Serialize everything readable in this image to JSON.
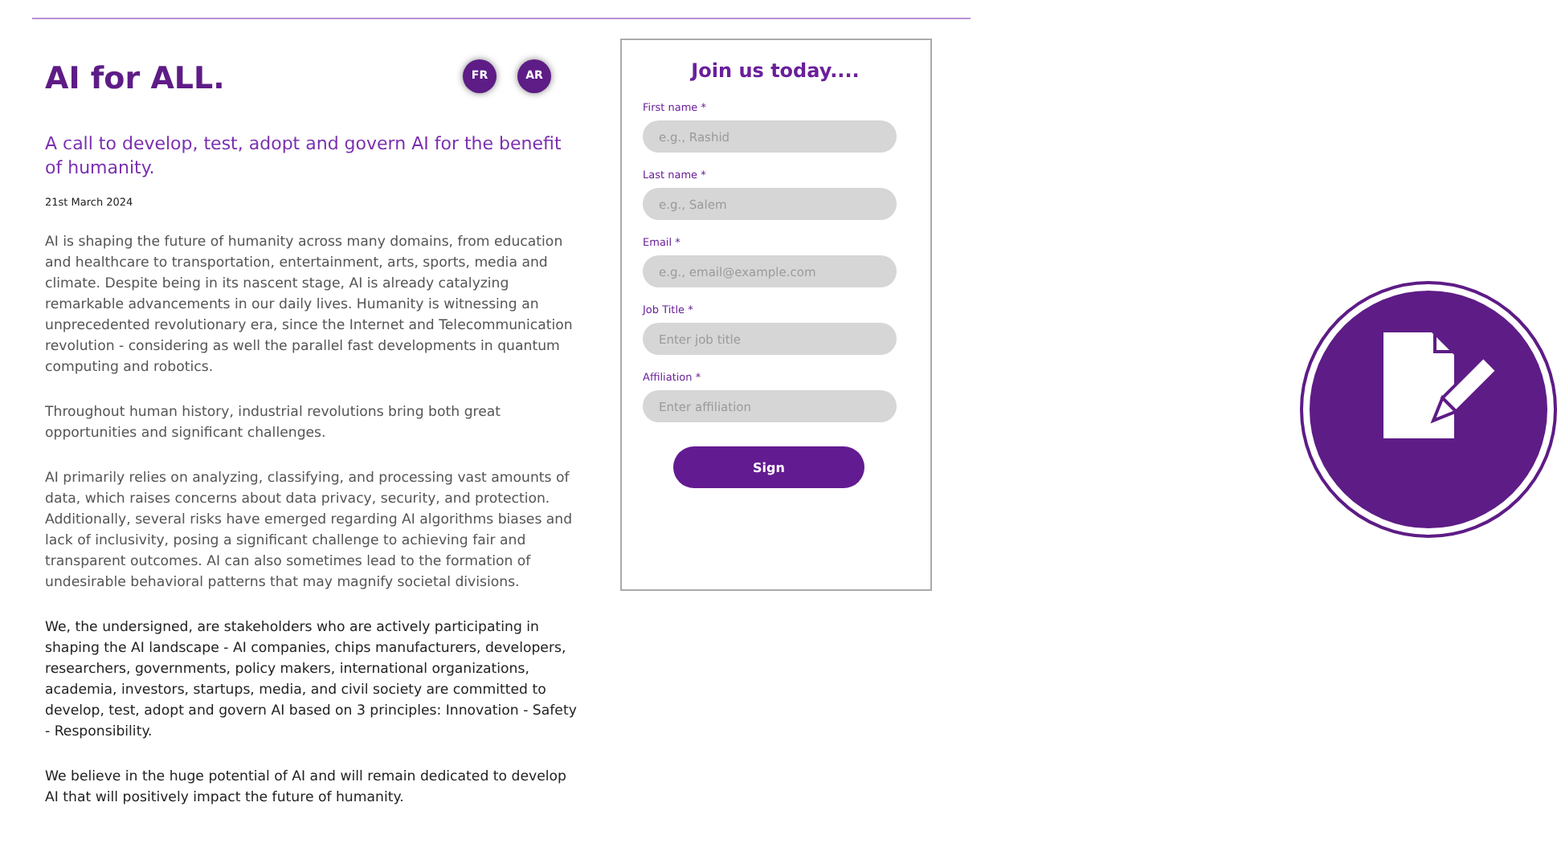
{
  "header": {
    "title": "AI for ALL.",
    "languages": [
      {
        "label": "FR"
      },
      {
        "label": "AR"
      }
    ]
  },
  "subtitle": "A call to develop, test, adopt and govern AI for the benefit of humanity.",
  "date": "21st March 2024",
  "paragraphs": [
    {
      "text": "AI is shaping the future of humanity across many domains, from education and healthcare to transportation, entertainment, arts, sports, media and climate. Despite being in its nascent stage, AI is already catalyzing remarkable advancements in our daily lives. Humanity is witnessing an unprecedented revolutionary era, since the Internet and Telecommunication revolution - considering as well the parallel fast developments in quantum computing and robotics.",
      "emphasis": false
    },
    {
      "text": "Throughout human history, industrial revolutions bring both great opportunities and significant challenges.",
      "emphasis": false
    },
    {
      "text": "AI primarily relies on analyzing, classifying, and processing vast amounts of data, which raises concerns about data privacy, security, and protection. Additionally, several risks have emerged regarding AI algorithms biases and lack of inclusivity, posing a significant challenge to achieving fair and transparent outcomes. AI can also sometimes lead to the formation of undesirable behavioral patterns that may magnify societal divisions.",
      "emphasis": false
    },
    {
      "text": "We, the undersigned, are stakeholders who are actively participating in shaping the AI landscape - AI companies, chips manufacturers, developers, researchers, governments, policy makers, international organizations, academia, investors, startups, media, and civil society are committed to develop, test, adopt and govern AI based on 3 principles: Innovation - Safety - Responsibility.",
      "emphasis": true
    },
    {
      "text": "We believe in the huge potential of AI and will remain dedicated to develop AI that will positively impact the future of humanity.",
      "emphasis": true
    }
  ],
  "form": {
    "title": "Join us today....",
    "fields": [
      {
        "label": "First name *",
        "placeholder": "e.g., Rashid"
      },
      {
        "label": "Last name *",
        "placeholder": "e.g., Salem"
      },
      {
        "label": "Email *",
        "placeholder": "e.g., email@example.com"
      },
      {
        "label": "Job Title *",
        "placeholder": "Enter job title"
      },
      {
        "label": "Affiliation *",
        "placeholder": "Enter affiliation"
      }
    ],
    "submit": "Sign"
  }
}
